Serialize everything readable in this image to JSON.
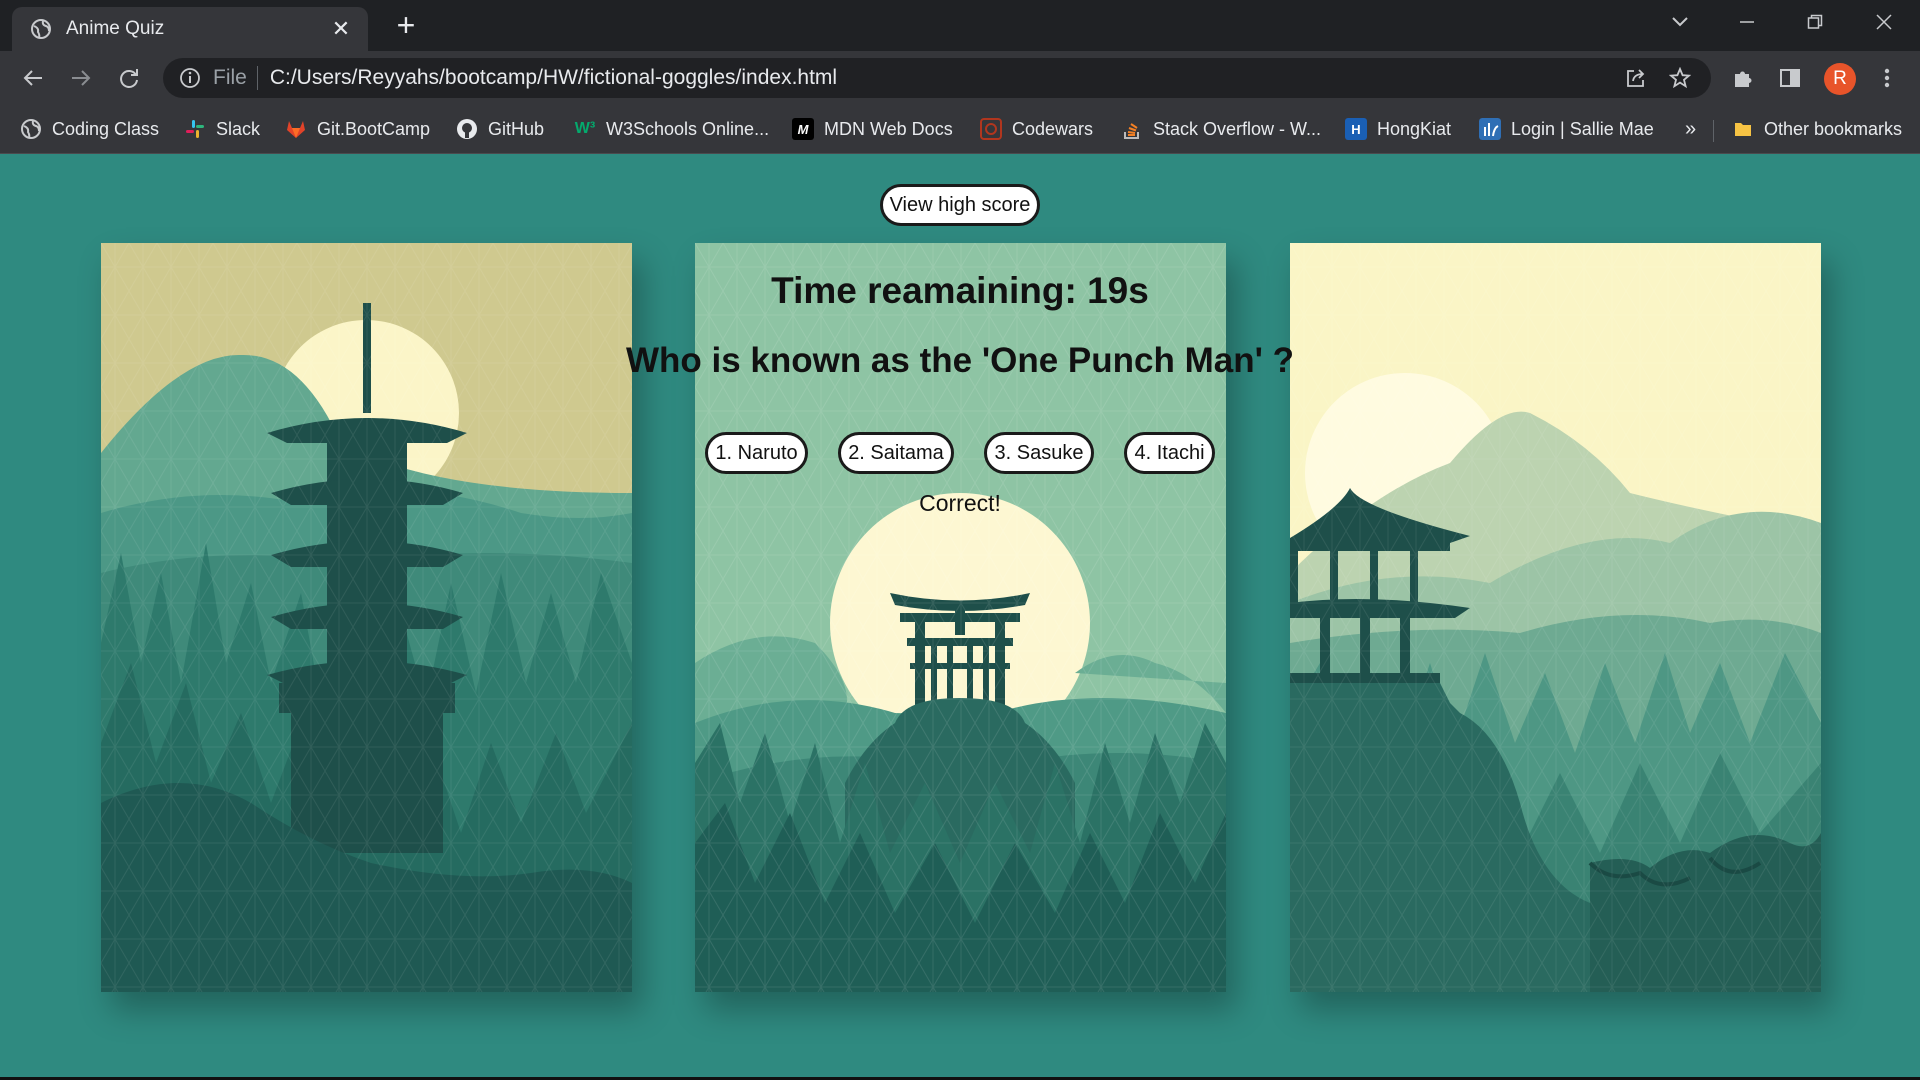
{
  "browser": {
    "tab_title": "Anime Quiz",
    "url_scheme": "File",
    "url": "C:/Users/Reyyahs/bootcamp/HW/fictional-goggles/index.html",
    "profile_initial": "R",
    "bookmarks": [
      {
        "label": "Coding Class",
        "icon": "globe-icon",
        "color": "#9aa0a6"
      },
      {
        "label": "Slack",
        "icon": "slack-icon",
        "color": "#e01e5a"
      },
      {
        "label": "Git.BootCamp",
        "icon": "gitlab-icon",
        "color": "#e24329"
      },
      {
        "label": "GitHub",
        "icon": "github-icon",
        "color": "#ffffff"
      },
      {
        "label": "W3Schools Online...",
        "icon": "w3schools-icon",
        "color": "#04aa6d"
      },
      {
        "label": "MDN Web Docs",
        "icon": "mdn-icon",
        "color": "#000000"
      },
      {
        "label": "Codewars",
        "icon": "codewars-icon",
        "color": "#b1361e"
      },
      {
        "label": "Stack Overflow - W...",
        "icon": "stackoverflow-icon",
        "color": "#f48024"
      },
      {
        "label": "HongKiat",
        "icon": "hongkiat-icon",
        "color": "#1a5fb4"
      },
      {
        "label": "Login | Sallie Mae",
        "icon": "salliemae-icon",
        "color": "#2f6fb5"
      }
    ],
    "overflow_label": "»",
    "other_bookmarks": "Other bookmarks"
  },
  "quiz": {
    "high_score_label": "View high score",
    "timer_text": "Time reamaining: 19s",
    "question": "Who is known as the 'One Punch Man' ?",
    "answers": [
      "1. Naruto",
      "2. Saitama",
      "3. Sasuke",
      "4. Itachi"
    ],
    "feedback": "Correct!"
  },
  "colors": {
    "page_bg": "#2f8a80",
    "accent_dark": "#1f4f4b",
    "sun": "#fdf7d2"
  }
}
